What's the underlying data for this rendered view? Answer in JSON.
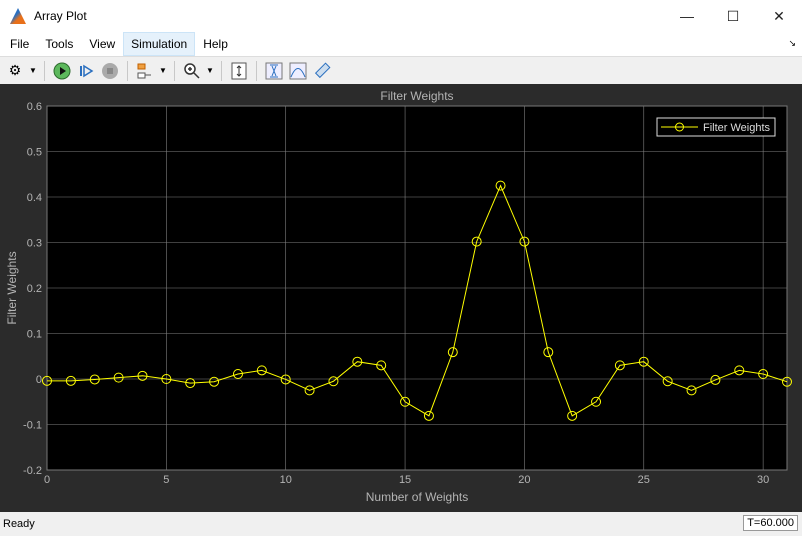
{
  "window": {
    "title": "Array Plot",
    "minimize": "—",
    "maximize": "☐",
    "close": "✕"
  },
  "menu": {
    "items": [
      "File",
      "Tools",
      "View",
      "Simulation",
      "Help"
    ],
    "corner": "↘"
  },
  "toolbar": {
    "icons": [
      "gear-icon",
      "run-icon",
      "step-forward-icon",
      "stop-icon",
      "signal-hierarchy-icon",
      "zoom-in-icon",
      "scale-axes-icon",
      "cursor-measurements-icon",
      "peak-finder-icon",
      "measurements-icon"
    ]
  },
  "status": {
    "text": "Ready",
    "time": "T=60.000"
  },
  "colors": {
    "trace": "#ffff00",
    "axes_bg": "#000000",
    "figure_bg": "#2b2b2b",
    "grid": "#808080",
    "text": "#b4b4b4"
  },
  "chart_data": {
    "type": "line",
    "title": "Filter Weights",
    "xlabel": "Number of Weights",
    "ylabel": "Filter Weights",
    "xlim": [
      0,
      31
    ],
    "ylim": [
      -0.2,
      0.6
    ],
    "xticks": [
      0,
      5,
      10,
      15,
      20,
      25,
      30
    ],
    "yticks": [
      -0.2,
      -0.1,
      0,
      0.1,
      0.2,
      0.3,
      0.4,
      0.5,
      0.6
    ],
    "grid": true,
    "legend": {
      "entries": [
        "Filter Weights"
      ],
      "placement": "top-right"
    },
    "marker": "circle",
    "x": [
      0,
      1,
      2,
      3,
      4,
      5,
      6,
      7,
      8,
      9,
      10,
      11,
      12,
      13,
      14,
      15,
      16,
      17,
      18,
      19,
      20,
      21,
      22,
      23,
      24,
      25,
      26,
      27,
      28,
      29,
      30,
      31
    ],
    "series": [
      {
        "name": "Filter Weights",
        "values": [
          -0.004,
          -0.004,
          -0.001,
          0.003,
          0.007,
          0.0,
          -0.009,
          -0.006,
          0.011,
          0.019,
          -0.001,
          -0.025,
          -0.005,
          0.038,
          0.03,
          -0.05,
          -0.081,
          0.059,
          0.302,
          0.425,
          0.302,
          0.059,
          -0.081,
          -0.05,
          0.03,
          0.038,
          -0.005,
          -0.025,
          -0.002,
          0.019,
          0.011,
          -0.006
        ]
      }
    ]
  }
}
